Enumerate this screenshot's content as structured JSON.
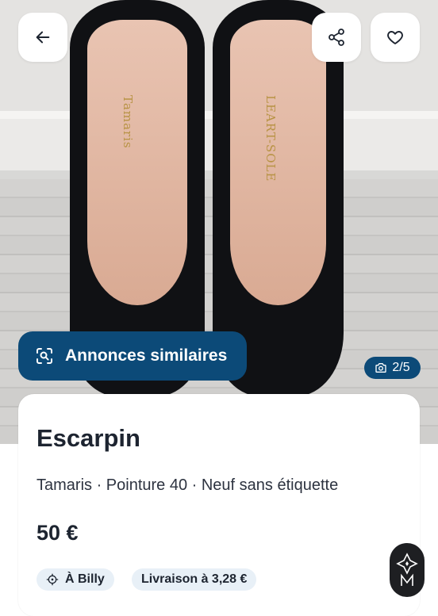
{
  "photo": {
    "brand_print": "Tamaris",
    "brand_print_2": "LEART-SOLE",
    "counter": "2/5"
  },
  "header": {
    "back_icon": "arrow-left-icon",
    "share_icon": "share-icon",
    "favorite_icon": "heart-icon"
  },
  "similar_button": {
    "label": "Annonces similaires",
    "icon": "visual-search-icon"
  },
  "listing": {
    "title": "Escarpin",
    "subtitle": "Tamaris · Pointure 40 · Neuf sans étiquette",
    "price": "50 €",
    "location": "À Billy",
    "location_icon": "location-target-icon",
    "shipping": "Livraison à 3,28 €"
  },
  "colors": {
    "accent": "#0c4a78",
    "chip_bg": "#e8f0f7",
    "text": "#1d2430"
  }
}
